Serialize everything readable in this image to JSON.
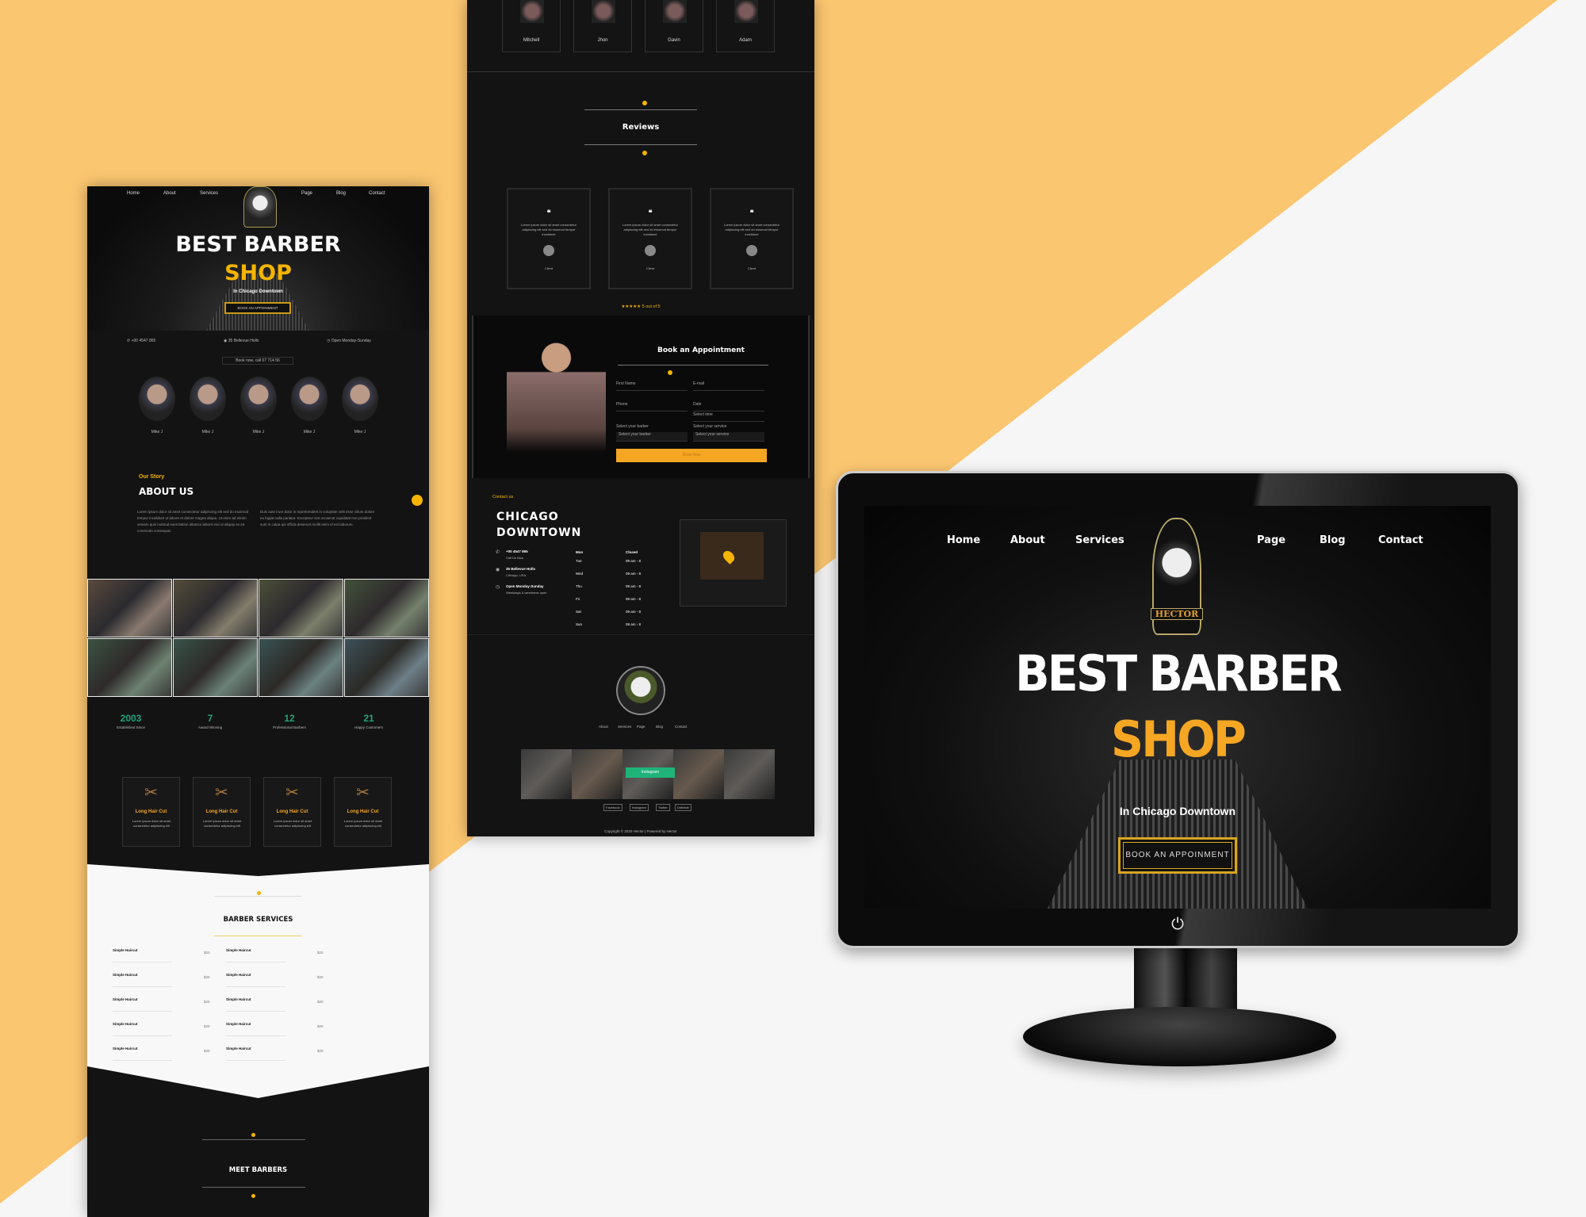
{
  "colors": {
    "accent": "#f5b400",
    "orange_bg": "#fbc670",
    "dark": "#131313",
    "stat_green": "#1fa37a"
  },
  "nav": [
    "Home",
    "About",
    "Services",
    "Page",
    "Blog",
    "Contact"
  ],
  "logo_text": "HECTOR",
  "hero": {
    "title": "BEST BARBER",
    "title_accent": "SHOP",
    "subtitle": "In Chicago Downtown",
    "button": "BOOK AN APPOINMENT"
  },
  "info": {
    "phone": "+00 4547 865",
    "address": "35 Bellevue Holls",
    "hours": "Open Monday-Sunday",
    "call": "Book now, call 07 714 56"
  },
  "barbers_small": [
    "Mike J",
    "Mike J",
    "Mike J",
    "Mike J",
    "Mike J"
  ],
  "about": {
    "kicker": "Our Story",
    "title": "ABOUT US",
    "para1": "Lorem ipsum dolor sit amet consectetur adipiscing elit sed do eiusmod tempor incididunt ut labore et dolore magna aliqua. Ut enim ad minim veniam quis nostrud exercitation ullamco laboris nisi ut aliquip ex ea commodo consequat.",
    "para2": "Duis aute irure dolor in reprehenderit in voluptate velit esse cillum dolore eu fugiat nulla pariatur. Excepteur sint occaecat cupidatat non proident sunt in culpa qui officia deserunt mollit anim id est laborum."
  },
  "stats": [
    {
      "value": "2003",
      "label": "Established Since"
    },
    {
      "value": "7",
      "label": "Award Winning"
    },
    {
      "value": "12",
      "label": "Professional Barbers"
    },
    {
      "value": "21",
      "label": "Happy Customers"
    }
  ],
  "service_cards": [
    {
      "title": "Long Hair Cut",
      "text": "Lorem ipsum dolor sit amet consectetur adipiscing elit"
    },
    {
      "title": "Long Hair Cut",
      "text": "Lorem ipsum dolor sit amet consectetur adipiscing elit"
    },
    {
      "title": "Long Hair Cut",
      "text": "Lorem ipsum dolor sit amet consectetur adipiscing elit"
    },
    {
      "title": "Long Hair Cut",
      "text": "Lorem ipsum dolor sit amet consectetur adipiscing elit"
    }
  ],
  "barber_services": {
    "title": "BARBER SERVICES",
    "items": [
      {
        "name": "Simple Haircut",
        "price": "$20"
      },
      {
        "name": "Simple Haircut",
        "price": "$20"
      },
      {
        "name": "Simple Haircut",
        "price": "$20"
      },
      {
        "name": "Simple Haircut",
        "price": "$20"
      },
      {
        "name": "Simple Haircut",
        "price": "$20"
      },
      {
        "name": "Simple Haircut",
        "price": "$20"
      },
      {
        "name": "Simple Haircut",
        "price": "$20"
      },
      {
        "name": "Simple Haircut",
        "price": "$20"
      },
      {
        "name": "Simple Haircut",
        "price": "$20"
      },
      {
        "name": "Simple Haircut",
        "price": "$20"
      }
    ]
  },
  "meet_barbers": {
    "title": "MEET BARBERS"
  },
  "team": [
    "Mitchell",
    "Jhon",
    "Gavin",
    "Adam"
  ],
  "reviews": {
    "title": "Reviews",
    "items": [
      {
        "text": "Lorem ipsum dolor sit amet consectetur adipiscing elit sed do eiusmod tempor incididunt",
        "name": "Client"
      },
      {
        "text": "Lorem ipsum dolor sit amet consectetur adipiscing elit sed do eiusmod tempor incididunt",
        "name": "Client"
      },
      {
        "text": "Lorem ipsum dolor sit amet consectetur adipiscing elit sed do eiusmod tempor incididunt",
        "name": "Client"
      }
    ],
    "rating": "★★★★★  5 out of 5"
  },
  "appointment": {
    "title": "Book an Appointment",
    "first_name": "First Name",
    "email": "E-mail",
    "phone": "Phone",
    "date": "Date",
    "time": "Select time",
    "barber_label": "Select your barber",
    "barber_value": "Select your barber",
    "service_label": "Select your service",
    "service_value": "Select your service",
    "submit": "Book Now"
  },
  "contact": {
    "kicker": "Contact us",
    "title1": "CHICAGO",
    "title2": "DOWNTOWN",
    "phone": "+00 4547 865",
    "phone_sub": "Call Us Now",
    "address": "35 Bellevue Holls",
    "address_sub": "Chicago, USA",
    "hours": "Open Monday-Sunday",
    "hours_sub": "Weekdays & weekends open",
    "table_head": [
      "Mon",
      "Closed"
    ],
    "table": [
      [
        "Tue",
        "09 am - 8"
      ],
      [
        "Wed",
        "09 am - 8"
      ],
      [
        "Thu",
        "09 am - 8"
      ],
      [
        "Fri",
        "09 am - 8"
      ],
      [
        "Sat",
        "09 am - 8"
      ],
      [
        "Sun",
        "09 am - 8"
      ]
    ]
  },
  "footer": {
    "links": [
      "About",
      "Services",
      "Page",
      "Blog",
      "Contact"
    ],
    "instagram": "Instagram",
    "social": [
      "Facebook",
      "Instagram",
      "Twitter",
      "Dribbble"
    ],
    "copyright": "Copyright © 2020 Hector | Powered by Hector"
  }
}
